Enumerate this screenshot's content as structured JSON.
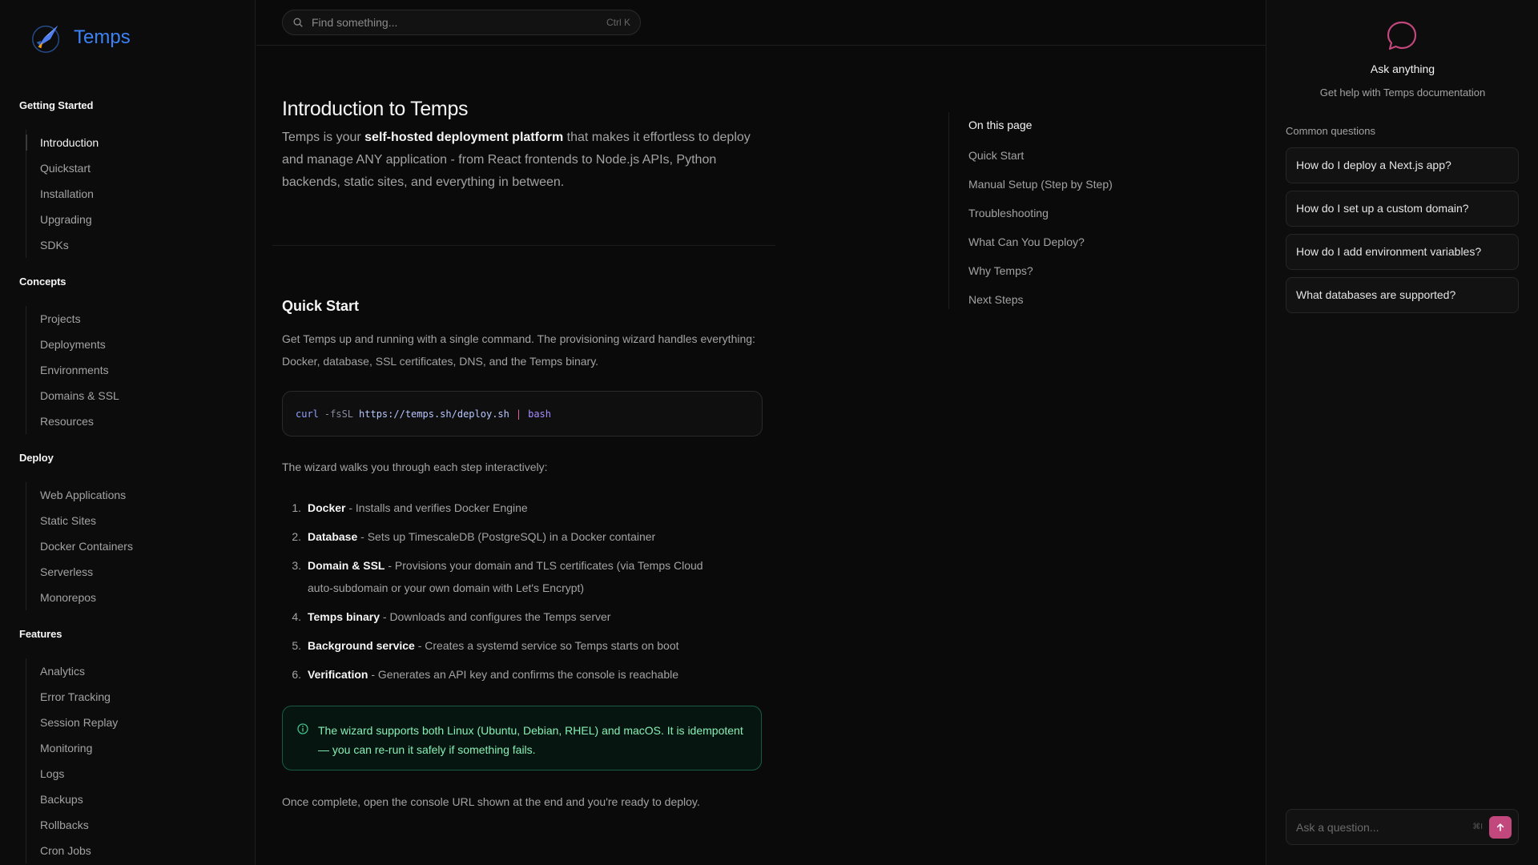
{
  "brand": {
    "name": "Temps"
  },
  "search": {
    "placeholder": "Find something...",
    "shortcut": "Ctrl K"
  },
  "sidebar": {
    "sections": [
      {
        "title": "Getting Started",
        "items": [
          "Introduction",
          "Quickstart",
          "Installation",
          "Upgrading",
          "SDKs"
        ]
      },
      {
        "title": "Concepts",
        "items": [
          "Projects",
          "Deployments",
          "Environments",
          "Domains & SSL",
          "Resources"
        ]
      },
      {
        "title": "Deploy",
        "items": [
          "Web Applications",
          "Static Sites",
          "Docker Containers",
          "Serverless",
          "Monorepos"
        ]
      },
      {
        "title": "Features",
        "items": [
          "Analytics",
          "Error Tracking",
          "Session Replay",
          "Monitoring",
          "Logs",
          "Backups",
          "Rollbacks",
          "Cron Jobs"
        ]
      }
    ],
    "active_item": "Introduction"
  },
  "page": {
    "title": "Introduction to Temps",
    "intro_prefix": "Temps is your ",
    "intro_bold": "self-hosted deployment platform",
    "intro_suffix": " that makes it effortless to deploy and manage ANY application - from React frontends to Node.js APIs, Python backends, static sites, and everything in between."
  },
  "quick_start": {
    "heading": "Quick Start",
    "description": "Get Temps up and running with a single command. The provisioning wizard handles everything: Docker, database, SSL certificates, DNS, and the Temps binary.",
    "code": {
      "cmd": "curl",
      "flag": "-fsSL",
      "url": "https://temps.sh/deploy.sh",
      "pipe": "|",
      "shell": "bash"
    },
    "wizard_intro": "The wizard walks you through each step interactively:",
    "steps": [
      {
        "num": "1.",
        "title": "Docker",
        "text": " - Installs and verifies Docker Engine"
      },
      {
        "num": "2.",
        "title": "Database",
        "text": " - Sets up TimescaleDB (PostgreSQL) in a Docker container"
      },
      {
        "num": "3.",
        "title": "Domain & SSL",
        "text": " - Provisions your domain and TLS certificates (via Temps Cloud auto-subdomain or your own domain with Let's Encrypt)"
      },
      {
        "num": "4.",
        "title": "Temps binary",
        "text": " - Downloads and configures the Temps server"
      },
      {
        "num": "5.",
        "title": "Background service",
        "text": " - Creates a systemd service so Temps starts on boot"
      },
      {
        "num": "6.",
        "title": "Verification",
        "text": " - Generates an API key and confirms the console is reachable"
      }
    ],
    "note": "The wizard supports both Linux (Ubuntu, Debian, RHEL) and macOS. It is idempotent — you can re-run it safely if something fails.",
    "outro": "Once complete, open the console URL shown at the end and you're ready to deploy."
  },
  "toc": {
    "title": "On this page",
    "items": [
      "Quick Start",
      "Manual Setup (Step by Step)",
      "Troubleshooting",
      "What Can You Deploy?",
      "Why Temps?",
      "Next Steps"
    ]
  },
  "assistant": {
    "title": "Ask anything",
    "subtitle": "Get help with Temps documentation",
    "common_title": "Common questions",
    "questions": [
      "How do I deploy a Next.js app?",
      "How do I set up a custom domain?",
      "How do I add environment variables?",
      "What databases are supported?"
    ],
    "input_placeholder": "Ask a question...",
    "input_shortcut": "⌘I",
    "accent_color": "#c2477c"
  },
  "colors": {
    "brand": "#3b82f6",
    "note_border": "#165c45",
    "note_text": "#86efb5"
  }
}
